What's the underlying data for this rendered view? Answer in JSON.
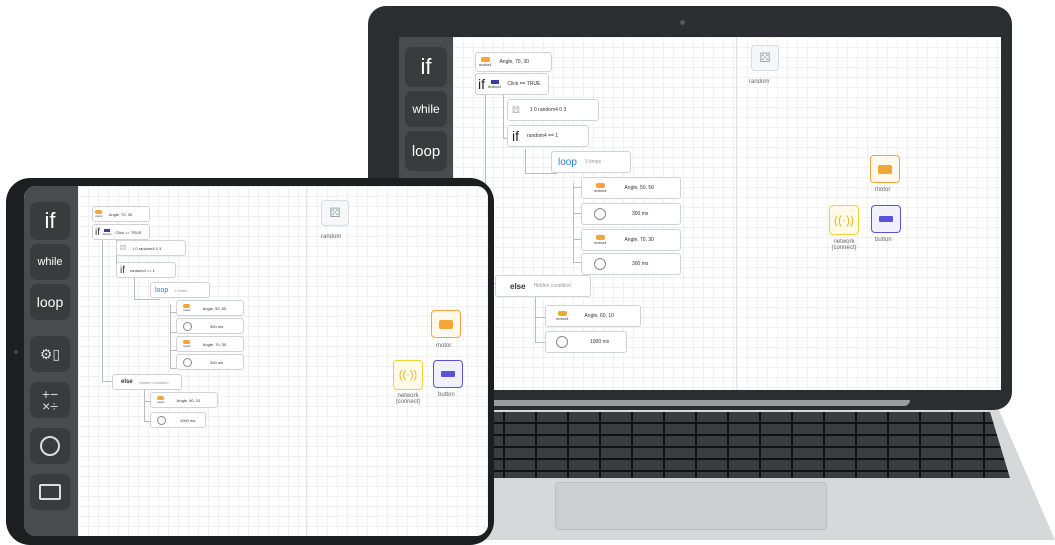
{
  "laptop": {
    "sidebar": [
      "if",
      "while",
      "loop"
    ],
    "blocks": {
      "motor_top": {
        "sub": "motor4",
        "text": "Angle, 70, 30"
      },
      "if1": {
        "kw": "if",
        "sub": "button4",
        "text": "Click  == TRUE"
      },
      "random": {
        "text": "1  0  random4  0  3"
      },
      "if2": {
        "kw": "if",
        "text": "random4  == 1"
      },
      "loop": {
        "kw": "loop",
        "text": "3 times"
      },
      "motor_a": {
        "sub": "motor4",
        "text": "Angle, 50, 50"
      },
      "wait_a": {
        "text": "300 ms"
      },
      "motor_b": {
        "sub": "motor4",
        "text": "Angle, 70, 30"
      },
      "wait_b": {
        "text": "300 ms"
      },
      "else": {
        "kw": "else",
        "text": "Hidden condition"
      },
      "motor_c": {
        "sub": "motor4",
        "text": "Angle, 60, 10"
      },
      "wait_c": {
        "text": "1000 ms"
      }
    },
    "right_panel": {
      "random_label": "random",
      "motor_label": "motor",
      "network_label": "network\n(connect)",
      "button_label": "button"
    }
  },
  "tablet": {
    "sidebar": [
      "if",
      "while",
      "loop"
    ],
    "blocks": {
      "motor_top": {
        "sub": "motor",
        "text": "Angle, 70, 30"
      },
      "if1": {
        "kw": "if",
        "sub": "button",
        "text": "Click  == TRUE"
      },
      "random": {
        "text": "1  0  random4  0  3"
      },
      "if2": {
        "kw": "if",
        "text": "random4  == 1"
      },
      "loop": {
        "kw": "loop",
        "text": "3 times"
      },
      "motor_a": {
        "sub": "motor",
        "text": "Angle, 50, 50"
      },
      "wait_a": {
        "text": "300 ms"
      },
      "motor_b": {
        "sub": "motor",
        "text": "Angle, 70, 30"
      },
      "wait_b": {
        "text": "300 ms"
      },
      "else": {
        "kw": "else",
        "text": "Hidden condition"
      },
      "motor_c": {
        "sub": "motor",
        "text": "Angle, 60, 10"
      },
      "wait_c": {
        "text": "1000 ms"
      }
    },
    "right_panel": {
      "random_label": "random",
      "motor_label": "motor",
      "network_label": "network\n(connect)",
      "button_label": "button"
    }
  },
  "colors": {
    "motor": "#f4a538",
    "network": "#f5cf3a",
    "button": "#5b53d6",
    "sidebar": "#4a4b4e",
    "loop": "#2f7fd6"
  }
}
